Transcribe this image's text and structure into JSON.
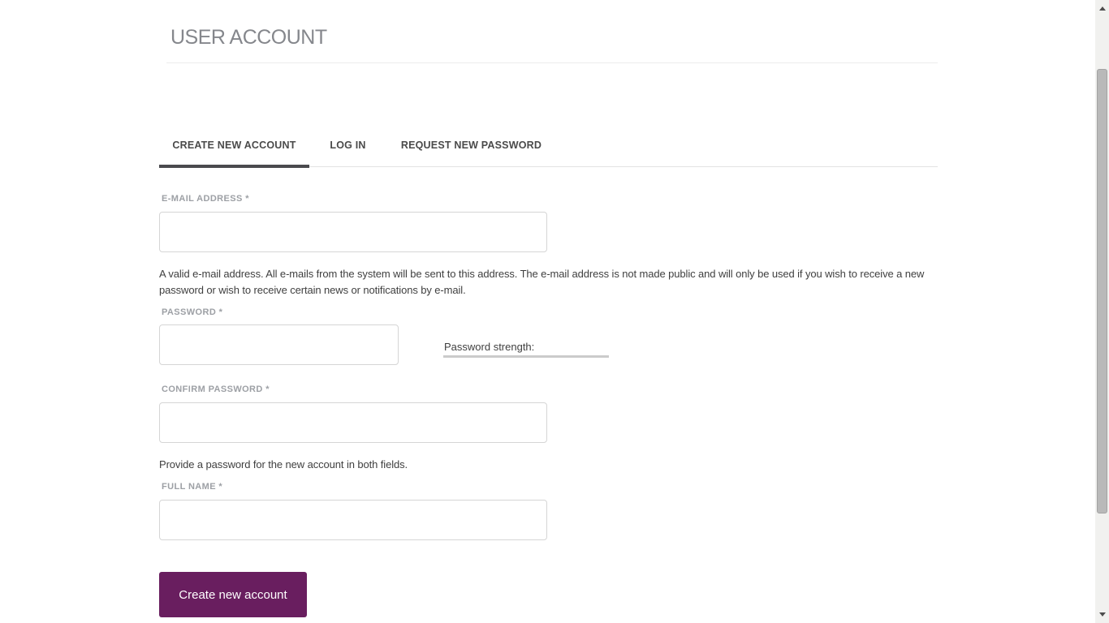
{
  "page": {
    "title": "USER ACCOUNT"
  },
  "tabs": [
    {
      "label": "CREATE NEW ACCOUNT",
      "active": true
    },
    {
      "label": "LOG IN",
      "active": false
    },
    {
      "label": "REQUEST NEW PASSWORD",
      "active": false
    }
  ],
  "form": {
    "email": {
      "label": "E-MAIL ADDRESS",
      "required_marker": "*",
      "value": "",
      "help": "A valid e-mail address. All e-mails from the system will be sent to this address. The e-mail address is not made public and will only be used if you wish to receive a new password or wish to receive certain news or notifications by e-mail."
    },
    "password": {
      "label": "PASSWORD",
      "required_marker": "*",
      "value": "",
      "strength_label": "Password strength:"
    },
    "confirm_password": {
      "label": "CONFIRM PASSWORD",
      "required_marker": "*",
      "value": "",
      "help": "Provide a password for the new account in both fields."
    },
    "full_name": {
      "label": "FULL NAME",
      "required_marker": "*",
      "value": ""
    },
    "submit_label": "Create new account"
  },
  "colors": {
    "accent": "#691e5f",
    "strength-bar": "#cbcbcb"
  }
}
